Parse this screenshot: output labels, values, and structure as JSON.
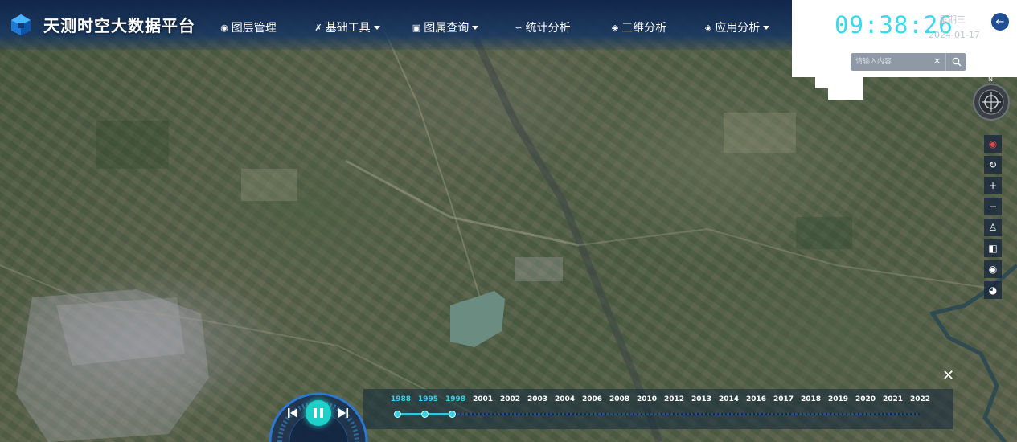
{
  "app": {
    "title": "天测时空大数据平台"
  },
  "nav": [
    {
      "label": "图层管理",
      "icon": "layers-icon",
      "has_dropdown": false
    },
    {
      "label": "基础工具",
      "icon": "tools-icon",
      "has_dropdown": true
    },
    {
      "label": "图属查询",
      "icon": "query-icon",
      "has_dropdown": true
    },
    {
      "label": "统计分析",
      "icon": "chart-icon",
      "has_dropdown": false
    },
    {
      "label": "三维分析",
      "icon": "cube-icon",
      "has_dropdown": false
    },
    {
      "label": "应用分析",
      "icon": "apps-icon",
      "has_dropdown": true
    }
  ],
  "clock": {
    "time": "09:38:26",
    "weekday": "星期三",
    "date": "2024-01-17"
  },
  "search": {
    "placeholder": "请输入内容",
    "value": ""
  },
  "compass": {
    "north_label": "N"
  },
  "toolbar": [
    {
      "name": "location-pin-icon"
    },
    {
      "name": "refresh-icon"
    },
    {
      "name": "zoom-in-icon"
    },
    {
      "name": "zoom-out-icon"
    },
    {
      "name": "street-view-icon"
    },
    {
      "name": "split-view-icon"
    },
    {
      "name": "eye-icon"
    },
    {
      "name": "globe-icon"
    }
  ],
  "timeline": {
    "years": [
      "1988",
      "1995",
      "1998",
      "2001",
      "2002",
      "2003",
      "2004",
      "2006",
      "2008",
      "2010",
      "2012",
      "2013",
      "2014",
      "2016",
      "2017",
      "2018",
      "2019",
      "2020",
      "2021",
      "2022"
    ],
    "active_years": [
      "1988",
      "1995",
      "1998"
    ],
    "state": "playing"
  },
  "colors": {
    "accent": "#34d2e6",
    "header": "#0e244a",
    "play": "#1fd0c8"
  }
}
